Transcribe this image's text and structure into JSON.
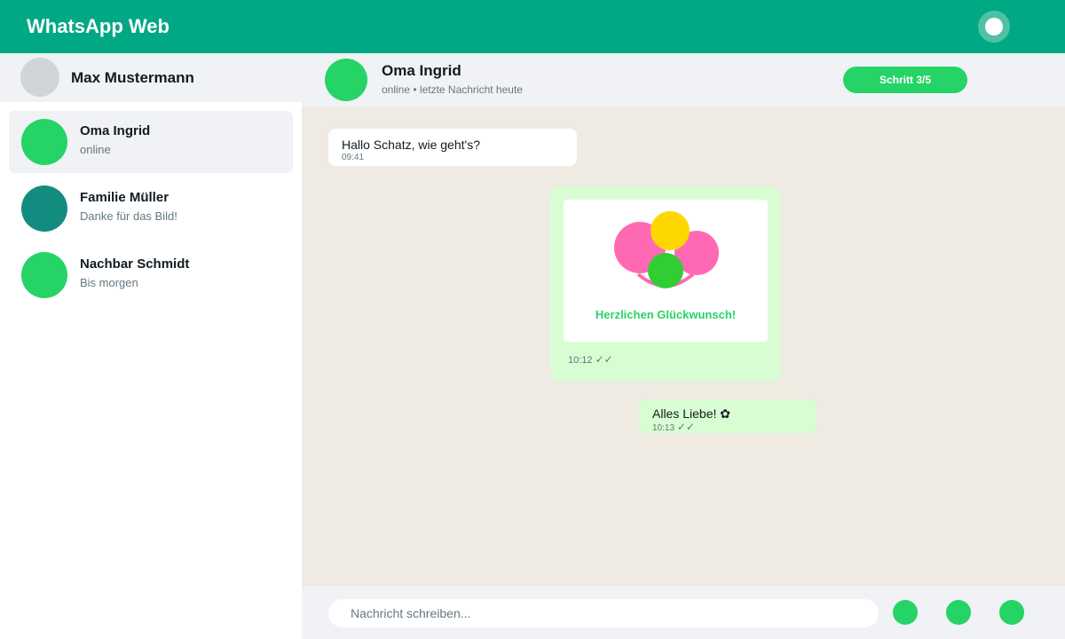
{
  "app": {
    "title": "WhatsApp Web"
  },
  "colors": {
    "brand": "#00a884",
    "accent": "#25d366",
    "outgoing_bubble": "#d9fdd3",
    "chat_background": "#efeae2",
    "teal_avatar": "#128c7e"
  },
  "topbar": {
    "status_icon": "status-circle-icon"
  },
  "profile": {
    "name": "Max Mustermann"
  },
  "chats": [
    {
      "name": "Oma Ingrid",
      "preview": "online",
      "avatar_color": "#25d366",
      "active": true
    },
    {
      "name": "Familie Müller",
      "preview": "Danke für das Bild!",
      "avatar_color": "#128c7e",
      "active": false
    },
    {
      "name": "Nachbar Schmidt",
      "preview": "Bis morgen",
      "avatar_color": "#25d366",
      "active": false
    }
  ],
  "conversation": {
    "contact_name": "Oma Ingrid",
    "status": "online • letzte Nachricht heute",
    "step_label": "Schritt 3/5",
    "messages": [
      {
        "direction": "in",
        "text": "Hallo Schatz, wie geht's?",
        "time": "09:41"
      },
      {
        "direction": "out",
        "type": "image-card",
        "caption": "Herzlichen Glückwunsch!",
        "time": "10:12",
        "ticks": "✓✓"
      },
      {
        "direction": "out",
        "text": "Alles Liebe! ✿",
        "time": "10:13",
        "ticks": "✓✓"
      }
    ]
  },
  "composer": {
    "placeholder": "Nachricht schreiben...",
    "buttons": [
      "emoji-button",
      "attach-button",
      "send-button"
    ]
  }
}
